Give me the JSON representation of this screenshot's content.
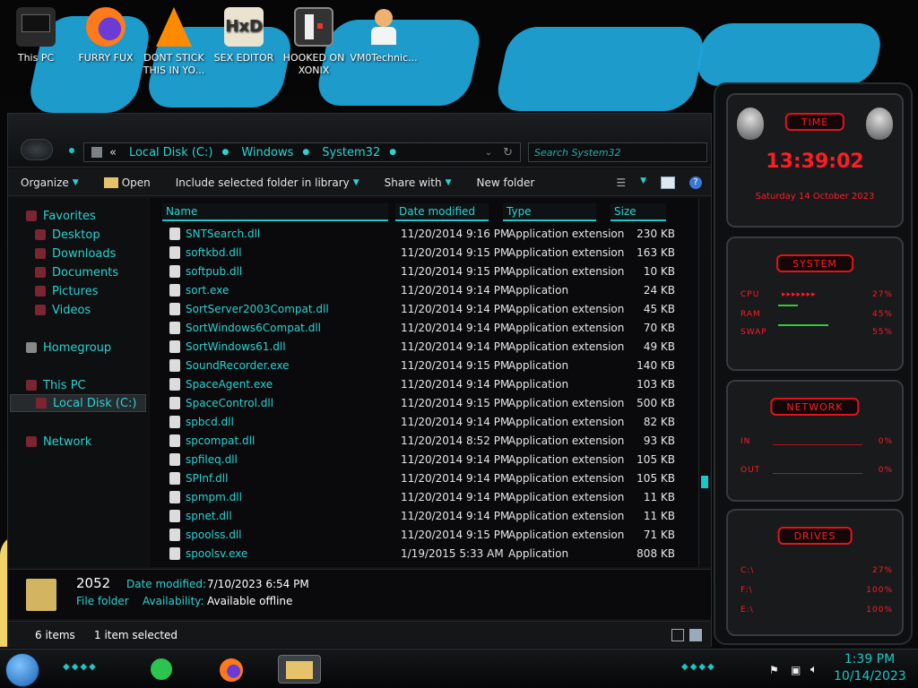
{
  "desktop": {
    "icons": [
      {
        "label": "This PC"
      },
      {
        "label": "FURRY FUX"
      },
      {
        "label": "DONT STICK THIS IN YO..."
      },
      {
        "label": "SEX EDITOR"
      },
      {
        "label": "HOOKED ON XONIX"
      },
      {
        "label": "VM0Technic..."
      }
    ]
  },
  "explorer": {
    "breadcrumb": [
      "Local Disk (C:)",
      "Windows",
      "System32"
    ],
    "breadcrumb_prefix": "«",
    "search_placeholder": "Search System32",
    "toolbar": {
      "organize": "Organize",
      "open": "Open",
      "include": "Include selected folder in library",
      "share": "Share with",
      "new_folder": "New folder"
    },
    "nav": {
      "favorites": "Favorites",
      "desktop": "Desktop",
      "downloads": "Downloads",
      "documents": "Documents",
      "pictures": "Pictures",
      "videos": "Videos",
      "homegroup": "Homegroup",
      "this_pc": "This PC",
      "local_disk": "Local Disk (C:)",
      "network": "Network"
    },
    "columns": {
      "name": "Name",
      "date": "Date modified",
      "type": "Type",
      "size": "Size"
    },
    "files": [
      {
        "name": "SNTSearch.dll",
        "date": "11/20/2014 9:16 PM",
        "type": "Application extension",
        "size": "230 KB"
      },
      {
        "name": "softkbd.dll",
        "date": "11/20/2014 9:15 PM",
        "type": "Application extension",
        "size": "163 KB"
      },
      {
        "name": "softpub.dll",
        "date": "11/20/2014 9:15 PM",
        "type": "Application extension",
        "size": "10 KB"
      },
      {
        "name": "sort.exe",
        "date": "11/20/2014 9:14 PM",
        "type": "Application",
        "size": "24 KB"
      },
      {
        "name": "SortServer2003Compat.dll",
        "date": "11/20/2014 9:14 PM",
        "type": "Application extension",
        "size": "45 KB"
      },
      {
        "name": "SortWindows6Compat.dll",
        "date": "11/20/2014 9:14 PM",
        "type": "Application extension",
        "size": "70 KB"
      },
      {
        "name": "SortWindows61.dll",
        "date": "11/20/2014 9:14 PM",
        "type": "Application extension",
        "size": "49 KB"
      },
      {
        "name": "SoundRecorder.exe",
        "date": "11/20/2014 9:15 PM",
        "type": "Application",
        "size": "140 KB"
      },
      {
        "name": "SpaceAgent.exe",
        "date": "11/20/2014 9:14 PM",
        "type": "Application",
        "size": "103 KB"
      },
      {
        "name": "SpaceControl.dll",
        "date": "11/20/2014 9:15 PM",
        "type": "Application extension",
        "size": "500 KB"
      },
      {
        "name": "spbcd.dll",
        "date": "11/20/2014 9:14 PM",
        "type": "Application extension",
        "size": "82 KB"
      },
      {
        "name": "spcompat.dll",
        "date": "11/20/2014 8:52 PM",
        "type": "Application extension",
        "size": "93 KB"
      },
      {
        "name": "spfileq.dll",
        "date": "11/20/2014 9:14 PM",
        "type": "Application extension",
        "size": "105 KB"
      },
      {
        "name": "SPInf.dll",
        "date": "11/20/2014 9:14 PM",
        "type": "Application extension",
        "size": "105 KB"
      },
      {
        "name": "spmpm.dll",
        "date": "11/20/2014 9:14 PM",
        "type": "Application extension",
        "size": "11 KB"
      },
      {
        "name": "spnet.dll",
        "date": "11/20/2014 9:14 PM",
        "type": "Application extension",
        "size": "11 KB"
      },
      {
        "name": "spoolss.dll",
        "date": "11/20/2014 9:15 PM",
        "type": "Application extension",
        "size": "71 KB"
      },
      {
        "name": "spoolsv.exe",
        "date": "1/19/2015 5:33 AM",
        "type": "Application",
        "size": "808 KB"
      }
    ],
    "details": {
      "name": "2052",
      "kind": "File folder",
      "date_label": "Date modified:",
      "date_value": "7/10/2023 6:54 PM",
      "avail_label": "Availability:",
      "avail_value": "Available offline"
    },
    "status": {
      "items": "6 items",
      "selected": "1 item selected"
    }
  },
  "gadget": {
    "time_title": "TIME",
    "time": "13:39:02",
    "date": "Saturday 14 October 2023",
    "system_title": "SYSTEM",
    "cpu_label": "CPU",
    "cpu_value": "27%",
    "ram_label": "RAM",
    "ram_value": "45%",
    "swap_label": "SWAP",
    "swap_value": "55%",
    "network_title": "NETWORK",
    "in_label": "IN",
    "in_value": "0%",
    "out_label": "OUT",
    "out_value": "0%",
    "drives_title": "DRIVES",
    "d1_label": "C:\\",
    "d1_value": "27%",
    "d2_label": "F:\\",
    "d2_value": "100%",
    "d3_label": "E:\\",
    "d3_value": "100%"
  },
  "taskbar": {
    "time": "1:39 PM",
    "date": "10/14/2023"
  },
  "colors": {
    "accent": "#2ad2d2",
    "gadget_red": "#ff1c24",
    "wallpaper_blue": "#1fa3d6"
  }
}
